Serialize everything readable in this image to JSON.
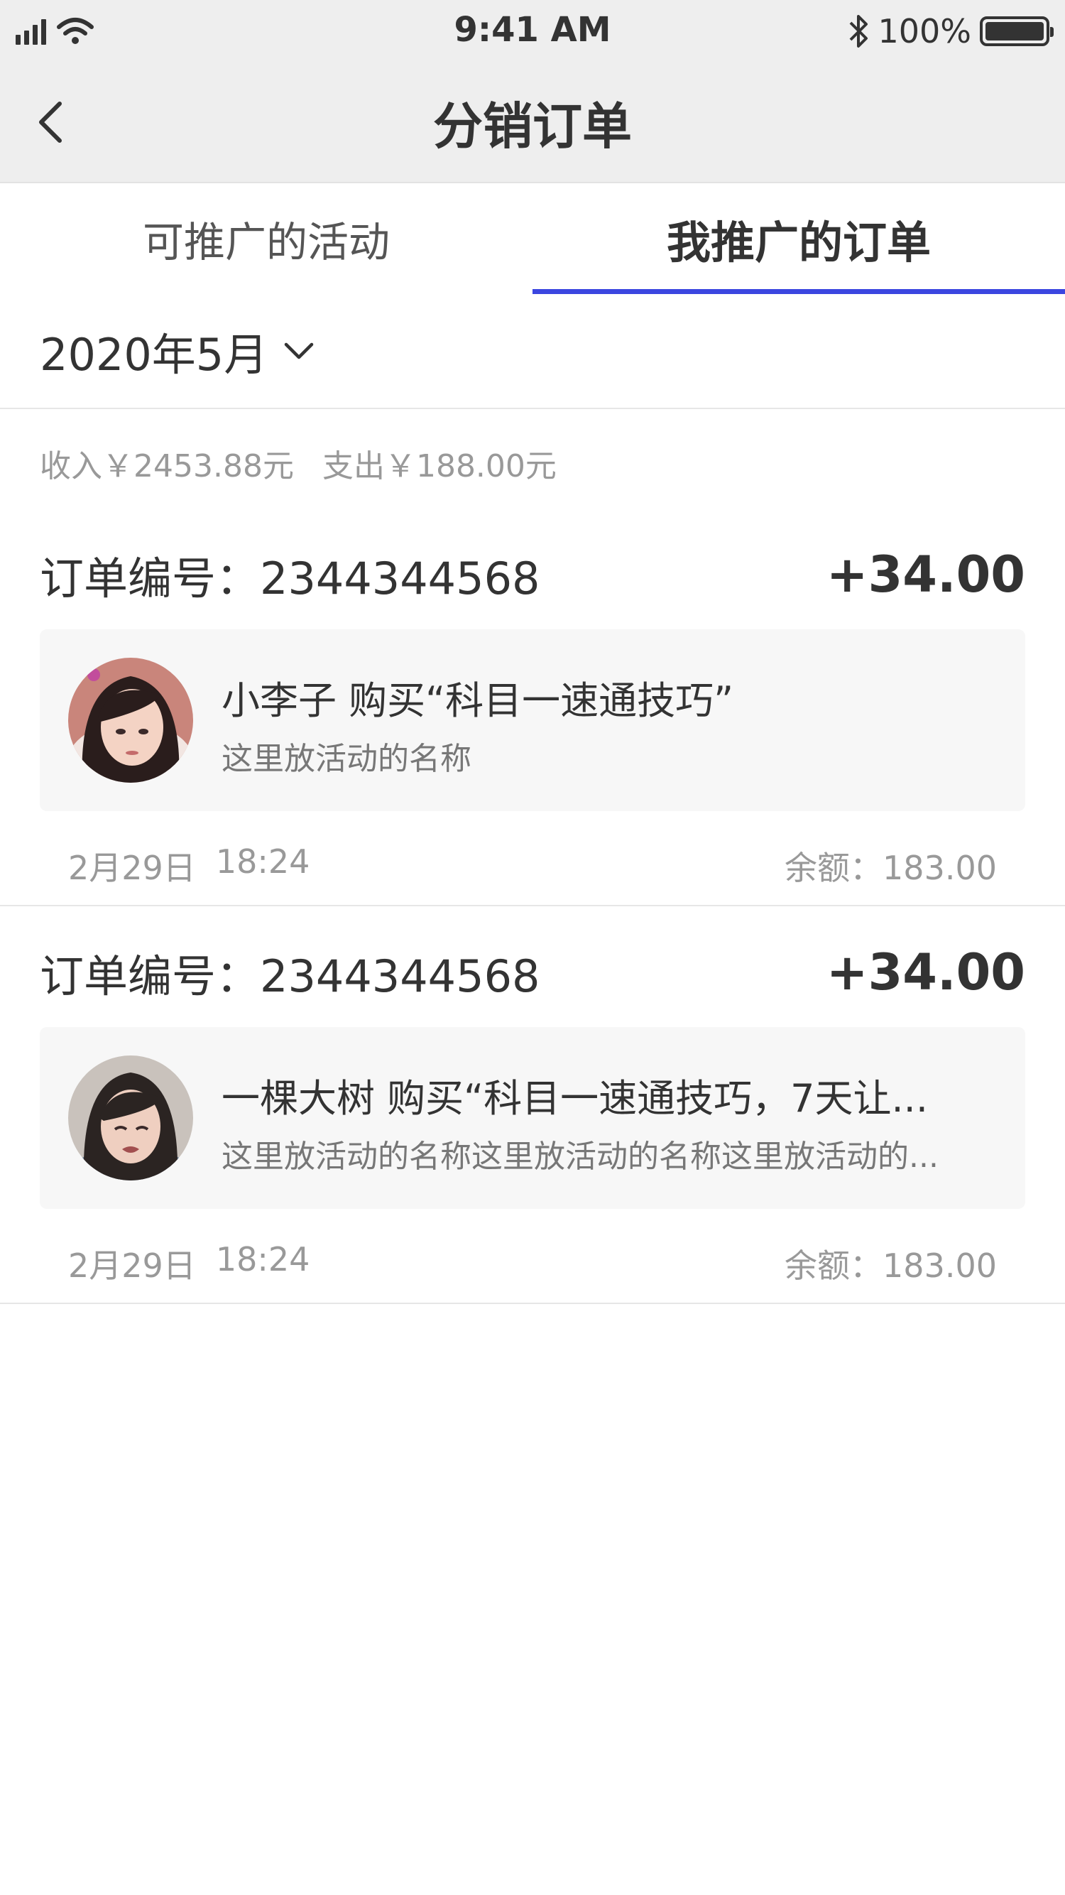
{
  "status_bar": {
    "time": "9:41 AM",
    "battery": "100%",
    "icons": [
      "signal-icon",
      "wifi-icon",
      "bluetooth-icon",
      "battery-icon"
    ]
  },
  "nav": {
    "title": "分销订单",
    "back_icon": "chevron-left-icon"
  },
  "tabs": [
    {
      "label": "可推广的活动",
      "active": false
    },
    {
      "label": "我推广的订单",
      "active": true
    }
  ],
  "filter": {
    "month": "2020年5月",
    "icon": "chevron-down-icon"
  },
  "summary": {
    "income": "收入￥2453.88元",
    "expense": "支出￥188.00元"
  },
  "orders": [
    {
      "number": "订单编号：2344344568",
      "amount": "+34.00",
      "title": "小李子 购买“科目一速通技巧”",
      "subtitle": "这里放活动的名称",
      "date": "2月29日",
      "time": "18:24",
      "balance": "余额：183.00"
    },
    {
      "number": "订单编号：2344344568",
      "amount": "+34.00",
      "title": "一棵大树 购买“科目一速通技巧，7天让...",
      "subtitle": "这里放活动的名称这里放活动的名称这里放活动的...",
      "date": "2月29日",
      "time": "18:24",
      "balance": "余额：183.00"
    }
  ],
  "colors": {
    "accent": "#3b46e0",
    "nav_background": "#eeeeee",
    "card_background": "#f7f7f7"
  }
}
